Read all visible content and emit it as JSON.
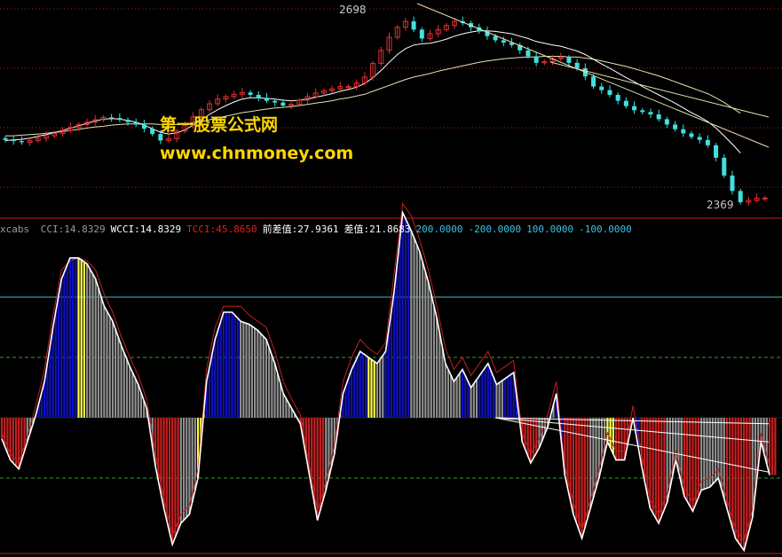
{
  "watermark": {
    "line1": "第一股票公式网",
    "line2": "www.chnmoney.com",
    "color": "#ffd700"
  },
  "price_panel": {
    "high_label": "2698",
    "low_label": "2369"
  },
  "indicator_legend": {
    "name": "xcabs",
    "items": [
      {
        "text": "CCI:14.8329",
        "color": "#9a9a9a"
      },
      {
        "text": "WCCI:14.8329",
        "color": "#ffffff"
      },
      {
        "text": "TCCI:45.8650",
        "color": "#e02020"
      },
      {
        "text": "前差值:27.9361",
        "color": "#ffffff"
      },
      {
        "text": "差值:21.8683",
        "color": "#ffffff"
      },
      {
        "text": "200.0000",
        "color": "#40c0e0"
      },
      {
        "text": "-200.0000",
        "color": "#40c0e0"
      },
      {
        "text": "100.0000",
        "color": "#40c0e0"
      },
      {
        "text": "-100.0000",
        "color": "#40c0e0"
      }
    ]
  },
  "colors": {
    "background": "#000000",
    "up_candle": "#e03030",
    "down_candle": "#40e0e0",
    "ma_line": "#e8e0b0",
    "grid_dotted": "#b02020",
    "bar_blue": "#1010c0",
    "bar_red": "#c82020",
    "bar_gray": "#909090",
    "bar_yellow": "#ffff40",
    "line_white": "#ffffff",
    "line_red": "#c02020",
    "level_200": "#40c0c0",
    "level_100": "#30a030"
  },
  "chart_data": [
    {
      "type": "candlestick",
      "y_range": [
        2369,
        2698
      ],
      "labels": {
        "high": "2698",
        "low": "2369"
      },
      "closes": [
        2480,
        2478,
        2476,
        2479,
        2483,
        2487,
        2491,
        2496,
        2501,
        2506,
        2510,
        2514,
        2518,
        2517,
        2514,
        2510,
        2506,
        2499,
        2490,
        2479,
        2482,
        2495,
        2505,
        2519,
        2531,
        2541,
        2549,
        2553,
        2557,
        2560,
        2556,
        2551,
        2546,
        2543,
        2538,
        2540,
        2547,
        2553,
        2559,
        2563,
        2566,
        2570,
        2570,
        2576,
        2586,
        2609,
        2631,
        2653,
        2670,
        2680,
        2666,
        2651,
        2659,
        2666,
        2673,
        2680,
        2677,
        2670,
        2663,
        2655,
        2648,
        2644,
        2640,
        2631,
        2621,
        2610,
        2612,
        2617,
        2619,
        2610,
        2601,
        2587,
        2570,
        2564,
        2556,
        2546,
        2537,
        2530,
        2527,
        2523,
        2515,
        2506,
        2498,
        2491,
        2485,
        2480,
        2471,
        2450,
        2420,
        2394,
        2375,
        2378,
        2382,
        2382
      ],
      "ma_fast": [
        2479,
        2480,
        2481,
        2483,
        2486,
        2489,
        2492,
        2496,
        2500,
        2504,
        2508,
        2512,
        2515,
        2516,
        2515,
        2513,
        2510,
        2505,
        2499,
        2493,
        2490,
        2492,
        2497,
        2505,
        2514,
        2523,
        2531,
        2538,
        2544,
        2549,
        2551,
        2551,
        2550,
        2549,
        2547,
        2546,
        2547,
        2549,
        2552,
        2555,
        2558,
        2562,
        2565,
        2569,
        2575,
        2585,
        2597,
        2611,
        2624,
        2634,
        2640,
        2642,
        2643,
        2646,
        2650,
        2655,
        2659,
        2662,
        2664,
        2664,
        2663,
        2661,
        2659,
        2655,
        2651,
        2646,
        2643,
        2640,
        2638,
        2634,
        2630,
        2624,
        2616,
        2608,
        2601,
        2593,
        2585,
        2578,
        2570,
        2563,
        2556,
        2549,
        2542,
        2534,
        2526,
        2519,
        2511,
        2500,
        2487,
        2473,
        2458
      ],
      "ma_slow": [
        2487,
        2487,
        2488,
        2489,
        2490,
        2491,
        2493,
        2494,
        2496,
        2498,
        2500,
        2502,
        2503,
        2505,
        2506,
        2507,
        2507,
        2507,
        2507,
        2506,
        2506,
        2506,
        2507,
        2509,
        2511,
        2514,
        2517,
        2520,
        2523,
        2526,
        2528,
        2530,
        2532,
        2534,
        2535,
        2536,
        2538,
        2540,
        2542,
        2544,
        2546,
        2549,
        2551,
        2554,
        2557,
        2562,
        2567,
        2572,
        2577,
        2582,
        2586,
        2589,
        2592,
        2596,
        2599,
        2602,
        2605,
        2608,
        2611,
        2613,
        2615,
        2617,
        2618,
        2619,
        2620,
        2620,
        2621,
        2621,
        2621,
        2620,
        2620,
        2618,
        2616,
        2613,
        2610,
        2607,
        2604,
        2600,
        2596,
        2592,
        2588,
        2583,
        2578,
        2573,
        2568,
        2563,
        2558,
        2551,
        2543,
        2534,
        2525
      ]
    },
    {
      "type": "bar",
      "indicator": "xcabs",
      "y_range": [
        -225,
        325
      ],
      "reference_levels": [
        200,
        -200,
        100,
        -100
      ],
      "series": [
        {
          "name": "CCI",
          "values": [
            -35,
            -70,
            -85,
            -40,
            5,
            60,
            150,
            230,
            265,
            265,
            255,
            230,
            185,
            160,
            120,
            85,
            55,
            15,
            -80,
            -150,
            -210,
            -175,
            -160,
            -100,
            60,
            130,
            175,
            175,
            160,
            155,
            145,
            130,
            90,
            40,
            15,
            -10,
            -90,
            -170,
            -120,
            -60,
            40,
            80,
            110,
            100,
            90,
            110,
            210,
            340,
            310,
            275,
            225,
            165,
            90,
            60,
            80,
            50,
            70,
            90,
            55,
            65,
            75,
            -40,
            -75,
            -50,
            -15,
            40,
            -95,
            -160,
            -200,
            -150,
            -100,
            -40,
            -70,
            -70,
            0,
            -80,
            -150,
            -175,
            -140,
            -70,
            -130,
            -155,
            -120,
            -115,
            -100,
            -150,
            -200,
            -220,
            -165,
            -40,
            -95
          ]
        },
        {
          "name": "TCCI",
          "values": [
            -25,
            -60,
            -75,
            -30,
            20,
            80,
            170,
            245,
            260,
            265,
            260,
            245,
            205,
            175,
            135,
            100,
            70,
            30,
            -60,
            -135,
            -195,
            -160,
            -145,
            -85,
            80,
            150,
            185,
            185,
            185,
            170,
            160,
            150,
            110,
            60,
            30,
            5,
            -75,
            -155,
            -105,
            -45,
            60,
            100,
            130,
            115,
            105,
            125,
            240,
            355,
            335,
            295,
            245,
            185,
            115,
            80,
            100,
            70,
            90,
            110,
            75,
            85,
            95,
            -25,
            -60,
            -35,
            5,
            60,
            -80,
            -140,
            -185,
            -135,
            -85,
            -25,
            -55,
            -55,
            20,
            -60,
            -135,
            -160,
            -125,
            -55,
            -115,
            -140,
            -105,
            -100,
            -85,
            -135,
            -185,
            -205,
            -150,
            -25,
            -80
          ]
        },
        {
          "name": "WCCI",
          "values": []
        }
      ]
    }
  ]
}
